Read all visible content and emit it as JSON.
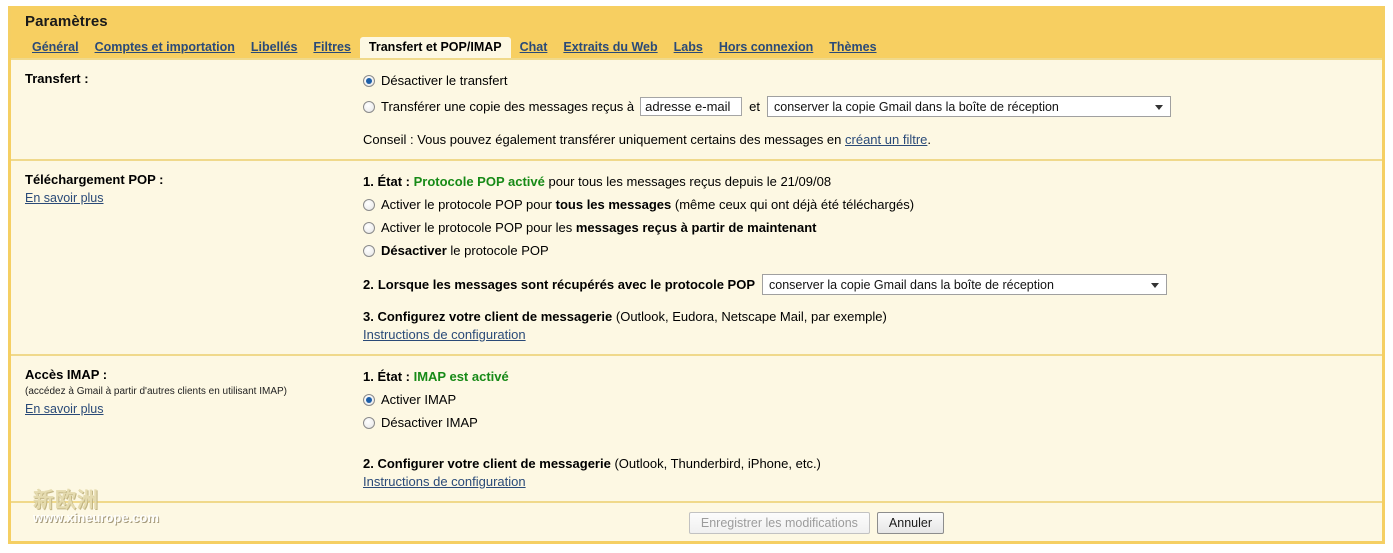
{
  "header": {
    "title": "Paramètres",
    "tabs": [
      {
        "label": "Général",
        "active": false
      },
      {
        "label": "Comptes et importation",
        "active": false
      },
      {
        "label": "Libellés",
        "active": false
      },
      {
        "label": "Filtres",
        "active": false
      },
      {
        "label": "Transfert et POP/IMAP",
        "active": true
      },
      {
        "label": "Chat",
        "active": false
      },
      {
        "label": "Extraits du Web",
        "active": false
      },
      {
        "label": "Labs",
        "active": false
      },
      {
        "label": "Hors connexion",
        "active": false
      },
      {
        "label": "Thèmes",
        "active": false
      }
    ]
  },
  "forwarding": {
    "section_label": "Transfert :",
    "option_disable": "Désactiver le transfert",
    "option_forward_prefix": "Transférer une copie des messages reçus à",
    "address_value": "adresse e-mail",
    "address_placeholder": "adresse e-mail",
    "and_label": "et",
    "keep_copy_selected": "conserver la copie Gmail dans la boîte de réception",
    "tip_prefix": "Conseil : Vous pouvez également transférer uniquement certains des messages en",
    "tip_link": "créant un filtre",
    "tip_suffix": "."
  },
  "pop": {
    "section_label": "Téléchargement POP :",
    "learn_more": "En savoir plus",
    "step1_num": "1.",
    "step1_label": "État :",
    "step1_status": "Protocole POP activé",
    "step1_rest": "pour tous les messages reçus depuis le 21/09/08",
    "opt_all_a": "Activer le protocole POP pour",
    "opt_all_b": "tous les messages",
    "opt_all_c": "(même ceux qui ont déjà été téléchargés)",
    "opt_new_a": "Activer le protocole POP pour les",
    "opt_new_b": "messages reçus à partir de maintenant",
    "opt_off_a": "Désactiver",
    "opt_off_b": "le protocole POP",
    "step2_num": "2.",
    "step2_label": "Lorsque les messages sont récupérés avec le protocole POP",
    "step2_selected": "conserver la copie Gmail dans la boîte de réception",
    "step3_num": "3.",
    "step3_label": "Configurez votre client de messagerie",
    "step3_rest": "(Outlook, Eudora, Netscape Mail, par exemple)",
    "config_link": "Instructions de configuration"
  },
  "imap": {
    "section_label": "Accès IMAP :",
    "section_sub": "(accédez à Gmail à partir d'autres clients en utilisant IMAP)",
    "learn_more": "En savoir plus",
    "step1_num": "1.",
    "step1_label": "État :",
    "step1_status": "IMAP est activé",
    "opt_enable": "Activer IMAP",
    "opt_disable": "Désactiver IMAP",
    "step2_num": "2.",
    "step2_label": "Configurer votre client de messagerie",
    "step2_rest": "(Outlook, Thunderbird, iPhone, etc.)",
    "config_link": "Instructions de configuration"
  },
  "footer": {
    "save_label": "Enregistrer les modifications",
    "cancel_label": "Annuler"
  },
  "watermark": {
    "cn": "新欧洲",
    "url": "www.xineurope.com"
  },
  "colors": {
    "header_bg": "#f7cf61",
    "body_bg": "#fdf8e3",
    "link": "#2a4a78",
    "status_green": "#178a17",
    "divider": "#f0d98b"
  }
}
